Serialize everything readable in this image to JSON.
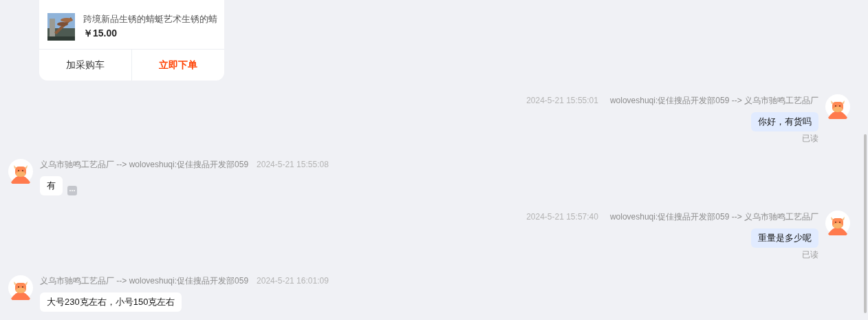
{
  "order_card": {
    "product": {
      "name": "跨境新品生锈的蜻蜓艺术生锈的蜻",
      "price": "￥15.00"
    },
    "actions": [
      {
        "label": "加采购车",
        "kind": "secondary"
      },
      {
        "label": "立即下单",
        "kind": "primary"
      }
    ]
  },
  "messages": [
    {
      "kind": "outgoing",
      "time": "2024-5-21 15:55:01",
      "route": "woloveshuqi:促佳搜品开发部059 --> 义乌市驰鸣工艺品厂",
      "text": "你好，有货吗",
      "status": "已读"
    },
    {
      "kind": "incoming",
      "route": "义乌市驰鸣工艺品厂 --> woloveshuqi:促佳搜品开发部059",
      "time": "2024-5-21 15:55:08",
      "text": "有",
      "more": true
    },
    {
      "kind": "outgoing",
      "time": "2024-5-21 15:57:40",
      "route": "woloveshuqi:促佳搜品开发部059 --> 义乌市驰鸣工艺品厂",
      "text": "重量是多少呢",
      "status": "已读"
    },
    {
      "kind": "incoming",
      "route": "义乌市驰鸣工艺品厂 --> woloveshuqi:促佳搜品开发部059",
      "time": "2024-5-21 16:01:09",
      "text": "大号230克左右，小号150克左右",
      "more": false
    }
  ]
}
